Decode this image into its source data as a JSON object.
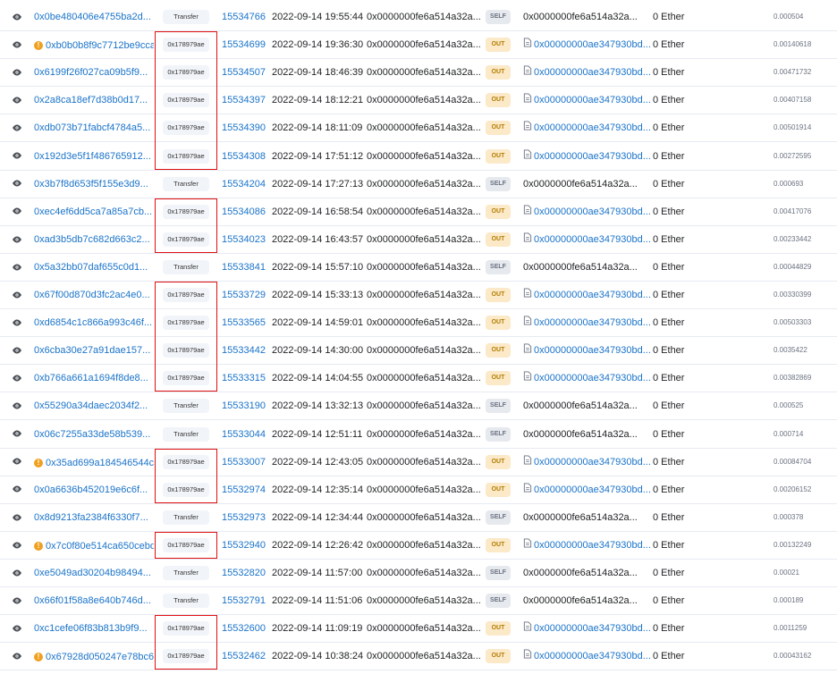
{
  "colors": {
    "link": "#1a73c9",
    "highlight": "#e01010",
    "out_bg": "#fbe9c8",
    "self_bg": "#e6e9ee"
  },
  "transactions": [
    {
      "hash": "0x0be480406e4755ba2d...",
      "warn": false,
      "method": "Transfer",
      "block": "15534766",
      "age": "2022-09-14 19:55:44",
      "from": "0x0000000fe6a514a32a...",
      "direction": "SELF",
      "to": "0x0000000fe6a514a32a...",
      "to_contract": false,
      "value": "0 Ether",
      "fee": "0.000504"
    },
    {
      "hash": "0xb0b0b8f9c7712be9cca...",
      "warn": true,
      "method": "0x178979ae",
      "block": "15534699",
      "age": "2022-09-14 19:36:30",
      "from": "0x0000000fe6a514a32a...",
      "direction": "OUT",
      "to": "0x00000000ae347930bd...",
      "to_contract": true,
      "value": "0 Ether",
      "fee": "0.00140618"
    },
    {
      "hash": "0x6199f26f027ca09b5f9...",
      "warn": false,
      "method": "0x178979ae",
      "block": "15534507",
      "age": "2022-09-14 18:46:39",
      "from": "0x0000000fe6a514a32a...",
      "direction": "OUT",
      "to": "0x00000000ae347930bd...",
      "to_contract": true,
      "value": "0 Ether",
      "fee": "0.00471732"
    },
    {
      "hash": "0x2a8ca18ef7d38b0d17...",
      "warn": false,
      "method": "0x178979ae",
      "block": "15534397",
      "age": "2022-09-14 18:12:21",
      "from": "0x0000000fe6a514a32a...",
      "direction": "OUT",
      "to": "0x00000000ae347930bd...",
      "to_contract": true,
      "value": "0 Ether",
      "fee": "0.00407158"
    },
    {
      "hash": "0xdb073b71fabcf4784a5...",
      "warn": false,
      "method": "0x178979ae",
      "block": "15534390",
      "age": "2022-09-14 18:11:09",
      "from": "0x0000000fe6a514a32a...",
      "direction": "OUT",
      "to": "0x00000000ae347930bd...",
      "to_contract": true,
      "value": "0 Ether",
      "fee": "0.00501914"
    },
    {
      "hash": "0x192d3e5f1f486765912...",
      "warn": false,
      "method": "0x178979ae",
      "block": "15534308",
      "age": "2022-09-14 17:51:12",
      "from": "0x0000000fe6a514a32a...",
      "direction": "OUT",
      "to": "0x00000000ae347930bd...",
      "to_contract": true,
      "value": "0 Ether",
      "fee": "0.00272595"
    },
    {
      "hash": "0x3b7f8d653f5f155e3d9...",
      "warn": false,
      "method": "Transfer",
      "block": "15534204",
      "age": "2022-09-14 17:27:13",
      "from": "0x0000000fe6a514a32a...",
      "direction": "SELF",
      "to": "0x0000000fe6a514a32a...",
      "to_contract": false,
      "value": "0 Ether",
      "fee": "0.000693"
    },
    {
      "hash": "0xec4ef6dd5ca7a85a7cb...",
      "warn": false,
      "method": "0x178979ae",
      "block": "15534086",
      "age": "2022-09-14 16:58:54",
      "from": "0x0000000fe6a514a32a...",
      "direction": "OUT",
      "to": "0x00000000ae347930bd...",
      "to_contract": true,
      "value": "0 Ether",
      "fee": "0.00417076"
    },
    {
      "hash": "0xad3b5db7c682d663c2...",
      "warn": false,
      "method": "0x178979ae",
      "block": "15534023",
      "age": "2022-09-14 16:43:57",
      "from": "0x0000000fe6a514a32a...",
      "direction": "OUT",
      "to": "0x00000000ae347930bd...",
      "to_contract": true,
      "value": "0 Ether",
      "fee": "0.00233442"
    },
    {
      "hash": "0x5a32bb07daf655c0d1...",
      "warn": false,
      "method": "Transfer",
      "block": "15533841",
      "age": "2022-09-14 15:57:10",
      "from": "0x0000000fe6a514a32a...",
      "direction": "SELF",
      "to": "0x0000000fe6a514a32a...",
      "to_contract": false,
      "value": "0 Ether",
      "fee": "0.00044829"
    },
    {
      "hash": "0x67f00d870d3fc2ac4e0...",
      "warn": false,
      "method": "0x178979ae",
      "block": "15533729",
      "age": "2022-09-14 15:33:13",
      "from": "0x0000000fe6a514a32a...",
      "direction": "OUT",
      "to": "0x00000000ae347930bd...",
      "to_contract": true,
      "value": "0 Ether",
      "fee": "0.00330399"
    },
    {
      "hash": "0xd6854c1c866a993c46f...",
      "warn": false,
      "method": "0x178979ae",
      "block": "15533565",
      "age": "2022-09-14 14:59:01",
      "from": "0x0000000fe6a514a32a...",
      "direction": "OUT",
      "to": "0x00000000ae347930bd...",
      "to_contract": true,
      "value": "0 Ether",
      "fee": "0.00503303"
    },
    {
      "hash": "0x6cba30e27a91dae157...",
      "warn": false,
      "method": "0x178979ae",
      "block": "15533442",
      "age": "2022-09-14 14:30:00",
      "from": "0x0000000fe6a514a32a...",
      "direction": "OUT",
      "to": "0x00000000ae347930bd...",
      "to_contract": true,
      "value": "0 Ether",
      "fee": "0.0035422"
    },
    {
      "hash": "0xb766a661a1694f8de8...",
      "warn": false,
      "method": "0x178979ae",
      "block": "15533315",
      "age": "2022-09-14 14:04:55",
      "from": "0x0000000fe6a514a32a...",
      "direction": "OUT",
      "to": "0x00000000ae347930bd...",
      "to_contract": true,
      "value": "0 Ether",
      "fee": "0.00382869"
    },
    {
      "hash": "0x55290a34daec2034f2...",
      "warn": false,
      "method": "Transfer",
      "block": "15533190",
      "age": "2022-09-14 13:32:13",
      "from": "0x0000000fe6a514a32a...",
      "direction": "SELF",
      "to": "0x0000000fe6a514a32a...",
      "to_contract": false,
      "value": "0 Ether",
      "fee": "0.000525"
    },
    {
      "hash": "0x06c7255a33de58b539...",
      "warn": false,
      "method": "Transfer",
      "block": "15533044",
      "age": "2022-09-14 12:51:11",
      "from": "0x0000000fe6a514a32a...",
      "direction": "SELF",
      "to": "0x0000000fe6a514a32a...",
      "to_contract": false,
      "value": "0 Ether",
      "fee": "0.000714"
    },
    {
      "hash": "0x35ad699a184546544c...",
      "warn": true,
      "method": "0x178979ae",
      "block": "15533007",
      "age": "2022-09-14 12:43:05",
      "from": "0x0000000fe6a514a32a...",
      "direction": "OUT",
      "to": "0x00000000ae347930bd...",
      "to_contract": true,
      "value": "0 Ether",
      "fee": "0.00084704"
    },
    {
      "hash": "0x0a6636b452019e6c6f...",
      "warn": false,
      "method": "0x178979ae",
      "block": "15532974",
      "age": "2022-09-14 12:35:14",
      "from": "0x0000000fe6a514a32a...",
      "direction": "OUT",
      "to": "0x00000000ae347930bd...",
      "to_contract": true,
      "value": "0 Ether",
      "fee": "0.00206152"
    },
    {
      "hash": "0x8d9213fa2384f6330f7...",
      "warn": false,
      "method": "Transfer",
      "block": "15532973",
      "age": "2022-09-14 12:34:44",
      "from": "0x0000000fe6a514a32a...",
      "direction": "SELF",
      "to": "0x0000000fe6a514a32a...",
      "to_contract": false,
      "value": "0 Ether",
      "fee": "0.000378"
    },
    {
      "hash": "0x7c0f80e514ca650cebd...",
      "warn": true,
      "method": "0x178979ae",
      "block": "15532940",
      "age": "2022-09-14 12:26:42",
      "from": "0x0000000fe6a514a32a...",
      "direction": "OUT",
      "to": "0x00000000ae347930bd...",
      "to_contract": true,
      "value": "0 Ether",
      "fee": "0.00132249"
    },
    {
      "hash": "0xe5049ad30204b98494...",
      "warn": false,
      "method": "Transfer",
      "block": "15532820",
      "age": "2022-09-14 11:57:00",
      "from": "0x0000000fe6a514a32a...",
      "direction": "SELF",
      "to": "0x0000000fe6a514a32a...",
      "to_contract": false,
      "value": "0 Ether",
      "fee": "0.00021"
    },
    {
      "hash": "0x66f01f58a8e640b746d...",
      "warn": false,
      "method": "Transfer",
      "block": "15532791",
      "age": "2022-09-14 11:51:06",
      "from": "0x0000000fe6a514a32a...",
      "direction": "SELF",
      "to": "0x0000000fe6a514a32a...",
      "to_contract": false,
      "value": "0 Ether",
      "fee": "0.000189"
    },
    {
      "hash": "0xc1cefe06f83b813b9f9...",
      "warn": false,
      "method": "0x178979ae",
      "block": "15532600",
      "age": "2022-09-14 11:09:19",
      "from": "0x0000000fe6a514a32a...",
      "direction": "OUT",
      "to": "0x00000000ae347930bd...",
      "to_contract": true,
      "value": "0 Ether",
      "fee": "0.0011259"
    },
    {
      "hash": "0x67928d050247e78bc6...",
      "warn": true,
      "method": "0x178979ae",
      "block": "15532462",
      "age": "2022-09-14 10:38:24",
      "from": "0x0000000fe6a514a32a...",
      "direction": "OUT",
      "to": "0x00000000ae347930bd...",
      "to_contract": true,
      "value": "0 Ether",
      "fee": "0.00043162"
    }
  ],
  "highlight_groups": [
    {
      "first_row": 1,
      "last_row": 5
    },
    {
      "first_row": 7,
      "last_row": 8
    },
    {
      "first_row": 10,
      "last_row": 13
    },
    {
      "first_row": 16,
      "last_row": 17
    },
    {
      "first_row": 19,
      "last_row": 19
    },
    {
      "first_row": 22,
      "last_row": 23
    }
  ]
}
